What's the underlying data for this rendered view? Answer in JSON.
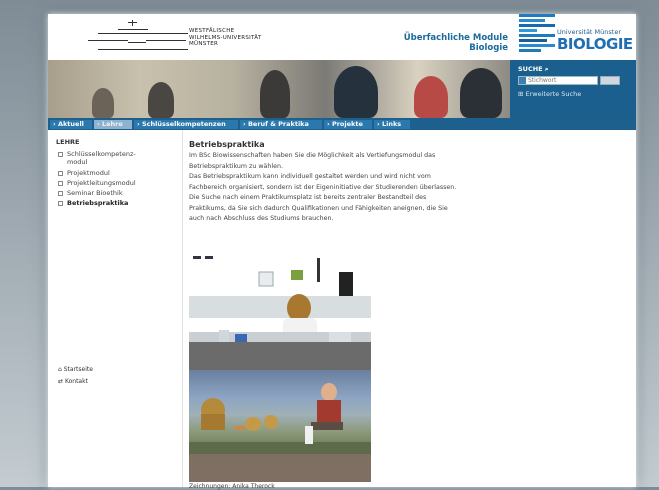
{
  "header": {
    "wwu_name_lines": [
      "Westfälische",
      "Wilhelms-Universität",
      "Münster"
    ],
    "site_title_line1": "Überfachliche Module",
    "site_title_line2": "Biologie",
    "uni_small": "Universität Münster",
    "uni_big": "BIOLOGIE"
  },
  "search": {
    "label": "SUCHE",
    "placeholder": "Stichwort",
    "advanced": "Erweiterte Suche"
  },
  "nav": {
    "items": [
      "Aktuell",
      "Lehre",
      "Schlüsselkompetenzen",
      "Beruf & Praktika",
      "Projekte",
      "Links"
    ]
  },
  "sidebar": {
    "heading": "LEHRE",
    "items": [
      "Schlüsselkompetenz-",
      "modul",
      "Projektmodul",
      "Projektleitungsmodul",
      "Seminar Bioethik",
      "Betriebspraktika"
    ],
    "util": [
      "Startseite",
      "Kontakt"
    ]
  },
  "main": {
    "title": "Betriebspraktika",
    "lines": [
      "Im BSc Biowissenschaften haben Sie die Möglichkeit als Vertiefungsmodul das",
      "Betriebspraktikum zu wählen.",
      "Das Betriebspraktikum kann individuell gestaltet werden und wird nicht vom",
      "Fachbereich organisiert, sondern ist der Eigeninitiative der Studierenden überlassen.",
      "Die Suche nach einem Praktikumsplatz ist bereits zentraler Bestandteil des",
      "Praktikums, da Sie sich dadurch Qualifikationen und Fähigkeiten aneignen, die Sie",
      "auch nach Abschluss des Studiums brauchen."
    ],
    "caption": "Zeichnungen: Anika Therock"
  },
  "colors": {
    "nav_bg": "#1d5f8d",
    "accent": "#1c6a9b"
  }
}
